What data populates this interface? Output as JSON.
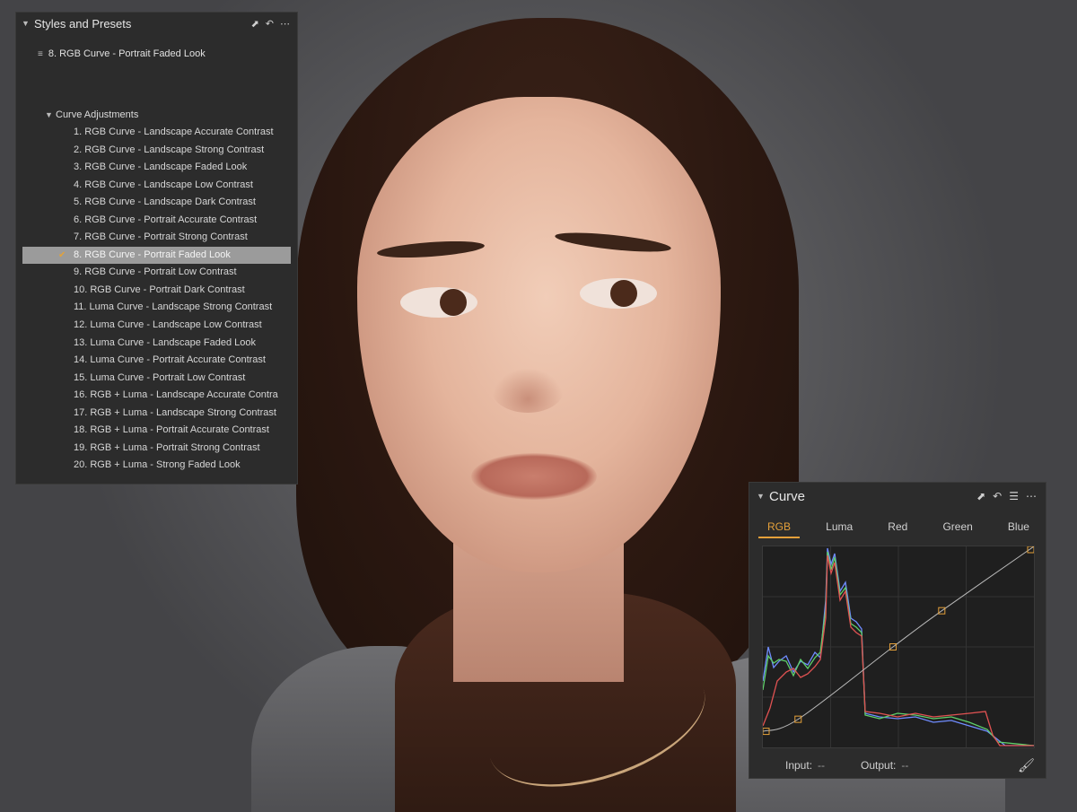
{
  "presets_panel": {
    "title": "Styles and Presets",
    "applied_style": "8. RGB Curve - Portrait Faded Look",
    "group_label": "Curve Adjustments",
    "items": [
      "1. RGB Curve - Landscape Accurate Contrast",
      "2. RGB Curve - Landscape Strong Contrast",
      "3. RGB Curve - Landscape Faded Look",
      "4. RGB Curve - Landscape Low Contrast",
      "5. RGB Curve - Landscape Dark Contrast",
      "6. RGB Curve - Portrait Accurate Contrast",
      "7. RGB Curve - Portrait Strong Contrast",
      "8. RGB Curve - Portrait Faded Look",
      "9. RGB Curve - Portrait Low Contrast",
      "10. RGB Curve - Portrait Dark Contrast",
      "11. Luma Curve - Landscape Strong Contrast",
      "12. Luma Curve - Landscape Low Contrast",
      "13. Luma Curve - Landscape Faded Look",
      "14. Luma Curve - Portrait Accurate Contrast",
      "15. Luma Curve - Portrait Low Contrast",
      "16. RGB + Luma - Landscape Accurate Contra",
      "17. RGB + Luma - Landscape Strong Contrast",
      "18. RGB + Luma - Portrait Accurate Contrast",
      "19. RGB + Luma - Portrait Strong Contrast",
      "20. RGB + Luma - Strong Faded Look"
    ],
    "selected_index": 7
  },
  "curve_panel": {
    "title": "Curve",
    "tabs": [
      "RGB",
      "Luma",
      "Red",
      "Green",
      "Blue"
    ],
    "active_tab": "RGB",
    "input_label": "Input:",
    "input_value": "--",
    "output_label": "Output:",
    "output_value": "--",
    "curve_points": [
      [
        0,
        0.08
      ],
      [
        0.13,
        0.14
      ],
      [
        0.48,
        0.5
      ],
      [
        0.66,
        0.68
      ],
      [
        1.0,
        1.0
      ]
    ]
  },
  "icons": {
    "collapse": "chevron-down-icon",
    "expand": "expand-icon",
    "reset": "reset-icon",
    "more": "more-icon",
    "menu": "menu-icon",
    "picker": "eyedropper-icon",
    "stack": "stack-icon",
    "check": "check-icon"
  },
  "colors": {
    "panel_bg": "#2c2c2c",
    "accent": "#e4a03a",
    "selection": "#9b9b9b",
    "hist_red": "#e05252",
    "hist_green": "#5fd06a",
    "hist_blue": "#6f8cff"
  }
}
